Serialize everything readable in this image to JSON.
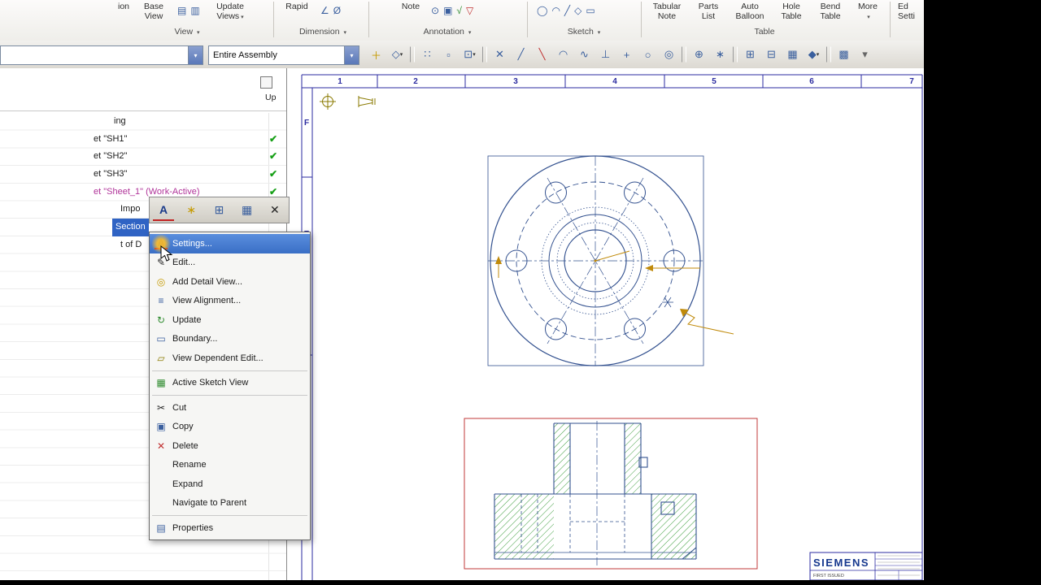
{
  "glyphs": {
    "caret": "▾"
  },
  "ribbon": {
    "view_group": {
      "frag": "ion",
      "base_view": "Base View",
      "update_views": "Update Views",
      "label": "View"
    },
    "view_icons": [
      {
        "glyph": "▤",
        "cls": "c-blue",
        "name": "view-style-icon"
      },
      {
        "glyph": "▥",
        "cls": "c-blue",
        "name": "view-display-icon"
      }
    ],
    "dimension_group": {
      "rapid": "Rapid",
      "label": "Dimension"
    },
    "dim_icons": [
      {
        "glyph": "∠",
        "cls": "c-blue",
        "name": "angular-dimension-icon"
      },
      {
        "glyph": "Ø",
        "cls": "c-blue",
        "name": "diameter-dimension-icon"
      }
    ],
    "annotation_group": {
      "note": "Note",
      "label": "Annotation"
    },
    "ann_icons": [
      {
        "glyph": "⊙",
        "cls": "c-blue",
        "name": "datum-target-icon"
      },
      {
        "glyph": "▣",
        "cls": "c-blue",
        "name": "image-icon"
      },
      {
        "glyph": "√",
        "cls": "c-green",
        "name": "surface-finish-icon"
      },
      {
        "glyph": "▽",
        "cls": "c-red",
        "name": "datum-feature-icon"
      }
    ],
    "sketch_group": {
      "label": "Sketch"
    },
    "sketch_icons": [
      {
        "glyph": "◯",
        "cls": "c-blue",
        "name": "circle-icon"
      },
      {
        "glyph": "◠",
        "cls": "c-blue",
        "name": "arc-icon"
      },
      {
        "glyph": "╱",
        "cls": "c-blue",
        "name": "line-icon"
      },
      {
        "glyph": "◇",
        "cls": "c-blue",
        "name": "polygon-icon"
      },
      {
        "glyph": "▭",
        "cls": "c-blue",
        "name": "rectangle-icon"
      }
    ],
    "table_group": {
      "tabular_note": "Tabular Note",
      "parts_list": "Parts List",
      "auto_balloon": "Auto Balloon",
      "hole_table": "Hole Table",
      "bend_table": "Bend Table",
      "more": "More",
      "label": "Table"
    },
    "edit_group": {
      "line1": "Ed",
      "line2": "Setti"
    }
  },
  "toolbar": {
    "combo1_value": "",
    "combo2_value": "Entire Assembly",
    "icons": [
      {
        "name": "snap-point-icon",
        "glyph": "＋",
        "cls": "c-gold"
      },
      {
        "name": "endpoint-snap-icon",
        "glyph": "◇",
        "cls": "c-blue",
        "caret": "▾"
      },
      {
        "name": "separator",
        "glyph": "",
        "cls": "sep"
      },
      {
        "name": "grid-snap-icon",
        "glyph": "∷",
        "cls": "c-blue"
      },
      {
        "name": "point-on-curve-icon",
        "glyph": "▫",
        "cls": "c-blue"
      },
      {
        "name": "snap-options-icon",
        "glyph": "⊡",
        "cls": "c-blue",
        "caret": "▾"
      },
      {
        "name": "separator",
        "glyph": "",
        "cls": "sep"
      },
      {
        "name": "point-icon",
        "glyph": "✕",
        "cls": "c-blue"
      },
      {
        "name": "line-icon",
        "glyph": "╱",
        "cls": "c-blue"
      },
      {
        "name": "detail-line-icon",
        "glyph": "╲",
        "cls": "c-red"
      },
      {
        "name": "arc-icon",
        "glyph": "◠",
        "cls": "c-blue"
      },
      {
        "name": "spline-icon",
        "glyph": "∿",
        "cls": "c-blue"
      },
      {
        "name": "perpendicular-icon",
        "glyph": "⊥",
        "cls": "c-blue"
      },
      {
        "name": "plus-icon",
        "glyph": "+",
        "cls": "c-blue"
      },
      {
        "name": "circle-icon",
        "glyph": "○",
        "cls": "c-blue"
      },
      {
        "name": "concentric-circle-icon",
        "glyph": "◎",
        "cls": "c-blue"
      },
      {
        "name": "separator",
        "glyph": "",
        "cls": "sep"
      },
      {
        "name": "crosshair-icon",
        "glyph": "⊕",
        "cls": "c-blue"
      },
      {
        "name": "asterisk-icon",
        "glyph": "∗",
        "cls": "c-blue"
      },
      {
        "name": "separator",
        "glyph": "",
        "cls": "sep"
      },
      {
        "name": "zoom-window-icon",
        "glyph": "⊞",
        "cls": "c-blue"
      },
      {
        "name": "fit-view-icon",
        "glyph": "⊟",
        "cls": "c-blue"
      },
      {
        "name": "grid-display-icon",
        "glyph": "▦",
        "cls": "c-blue"
      },
      {
        "name": "shaded-view-icon",
        "glyph": "◆",
        "cls": "c-blue",
        "caret": "▾"
      },
      {
        "name": "separator",
        "glyph": "",
        "cls": "sep"
      },
      {
        "name": "hatch-icon",
        "glyph": "▩",
        "cls": "c-blue"
      },
      {
        "name": "more-options-icon",
        "glyph": "▾",
        "cls": "c-gray"
      }
    ]
  },
  "navigator": {
    "up_header": "Up",
    "rows": [
      {
        "label": "ing",
        "check": "",
        "cls": "p140"
      },
      {
        "label": "et \"SH1\"",
        "check": "✔",
        "cls": "p115"
      },
      {
        "label": "et \"SH2\"",
        "check": "✔",
        "cls": "p115"
      },
      {
        "label": "et \"SH3\"",
        "check": "✔",
        "cls": "p115"
      },
      {
        "label": "et \"Sheet_1\" (Work-Active)",
        "check": "✔",
        "cls": "p115 magenta"
      },
      {
        "label": "Impo",
        "check": "",
        "cls": "p148"
      },
      {
        "label": "Section",
        "check": "",
        "cls": "p138 selrow"
      },
      {
        "label": "t of D",
        "check": "",
        "cls": "p148"
      }
    ]
  },
  "mini_toolbar": {
    "icons": [
      {
        "name": "annotation-style-icon",
        "glyph": "A",
        "cls": "ic-a"
      },
      {
        "name": "edit-style-icon",
        "glyph": "∗",
        "cls": "c-gold"
      },
      {
        "name": "view-window-icon",
        "glyph": "⊞",
        "cls": "c-blue"
      },
      {
        "name": "active-sketch-icon",
        "glyph": "▦",
        "cls": "c-blue"
      },
      {
        "name": "delete-icon",
        "glyph": "✕",
        "cls": "c-dark"
      }
    ]
  },
  "context_menu": {
    "group1": [
      {
        "label": "Settings...",
        "glyph": "A",
        "iconcls": "ic-a",
        "cls": "hl"
      },
      {
        "label": "Edit...",
        "glyph": "✎",
        "iconcls": "c-dark"
      },
      {
        "label": "Add Detail View...",
        "glyph": "◎",
        "iconcls": "c-gold"
      },
      {
        "label": "View Alignment...",
        "glyph": "≡",
        "iconcls": "c-blue"
      },
      {
        "label": "Update",
        "glyph": "↻",
        "iconcls": "c-green"
      },
      {
        "label": "Boundary...",
        "glyph": "▭",
        "iconcls": "c-blue"
      },
      {
        "label": "View Dependent Edit...",
        "glyph": "▱",
        "iconcls": "c-olive"
      }
    ],
    "group2": [
      {
        "label": "Active Sketch View",
        "glyph": "▦",
        "iconcls": "c-green"
      }
    ],
    "group3": [
      {
        "label": "Cut",
        "glyph": "✂",
        "iconcls": "c-dark"
      },
      {
        "label": "Copy",
        "glyph": "▣",
        "iconcls": "c-blue"
      },
      {
        "label": "Delete",
        "glyph": "✕",
        "iconcls": "c-red"
      },
      {
        "label": "Rename",
        "glyph": ""
      },
      {
        "label": "Expand",
        "glyph": ""
      },
      {
        "label": "Navigate to Parent",
        "glyph": ""
      }
    ],
    "group4": [
      {
        "label": "Properties",
        "glyph": "▤",
        "iconcls": "c-blue"
      }
    ]
  },
  "sheet": {
    "columns": [
      "1",
      "2",
      "3",
      "4",
      "5",
      "6",
      "7"
    ],
    "zones": [
      "F",
      "E"
    ]
  },
  "title_block": {
    "brand": "SIEMENS",
    "first_issued": "FIRST ISSUED"
  }
}
